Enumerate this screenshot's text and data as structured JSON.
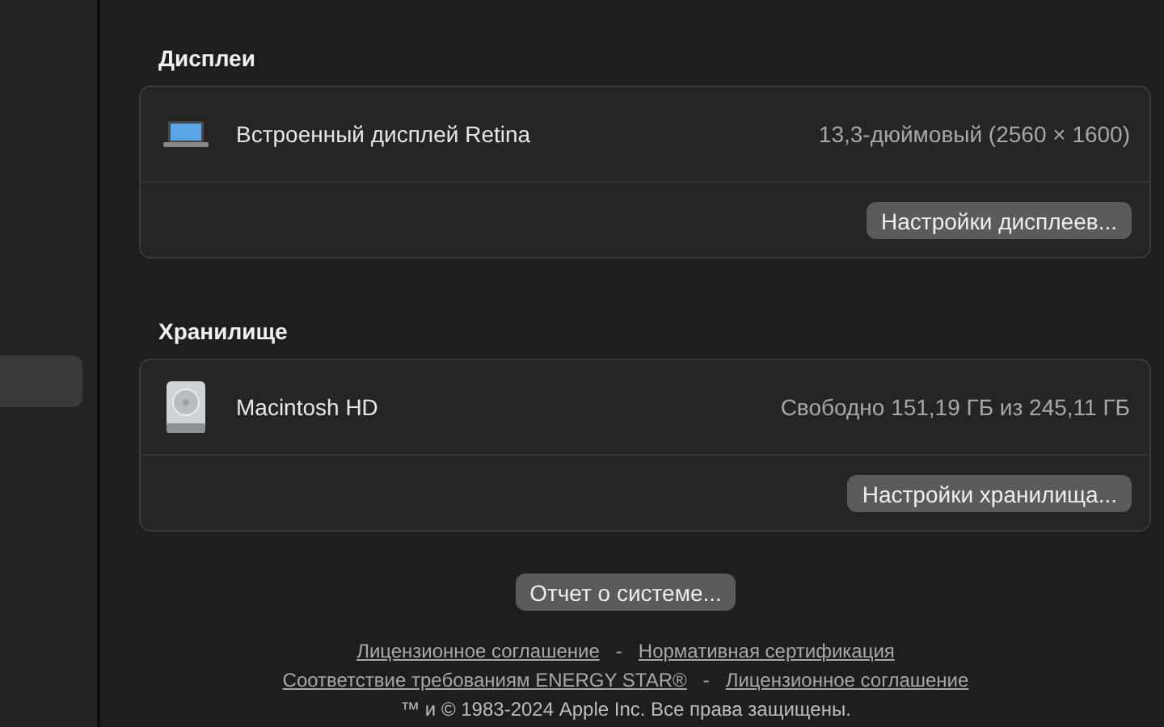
{
  "sidebar": {
    "items": [
      {
        "selected": true
      }
    ]
  },
  "sections": [
    {
      "title": "Дисплеи",
      "kind": "display",
      "name": "Встроенный дисплей Retina",
      "detail": "13,3-дюймовый (2560 × 1600)",
      "button": "Настройки дисплеев..."
    },
    {
      "title": "Хранилище",
      "kind": "disk",
      "name": "Macintosh HD",
      "detail": "Свободно 151,19 ГБ из 245,11 ГБ",
      "button": "Настройки хранилища..."
    }
  ],
  "report_button": "Отчет о системе...",
  "links": [
    [
      "Лицензионное соглашение",
      "Нормативная сертификация"
    ],
    [
      "Соответствие требованиям ENERGY STAR®",
      "Лицензионное соглашение"
    ]
  ],
  "separator": "-",
  "copyright": "™ и © 1983-2024 Apple Inc. Все права защищены."
}
